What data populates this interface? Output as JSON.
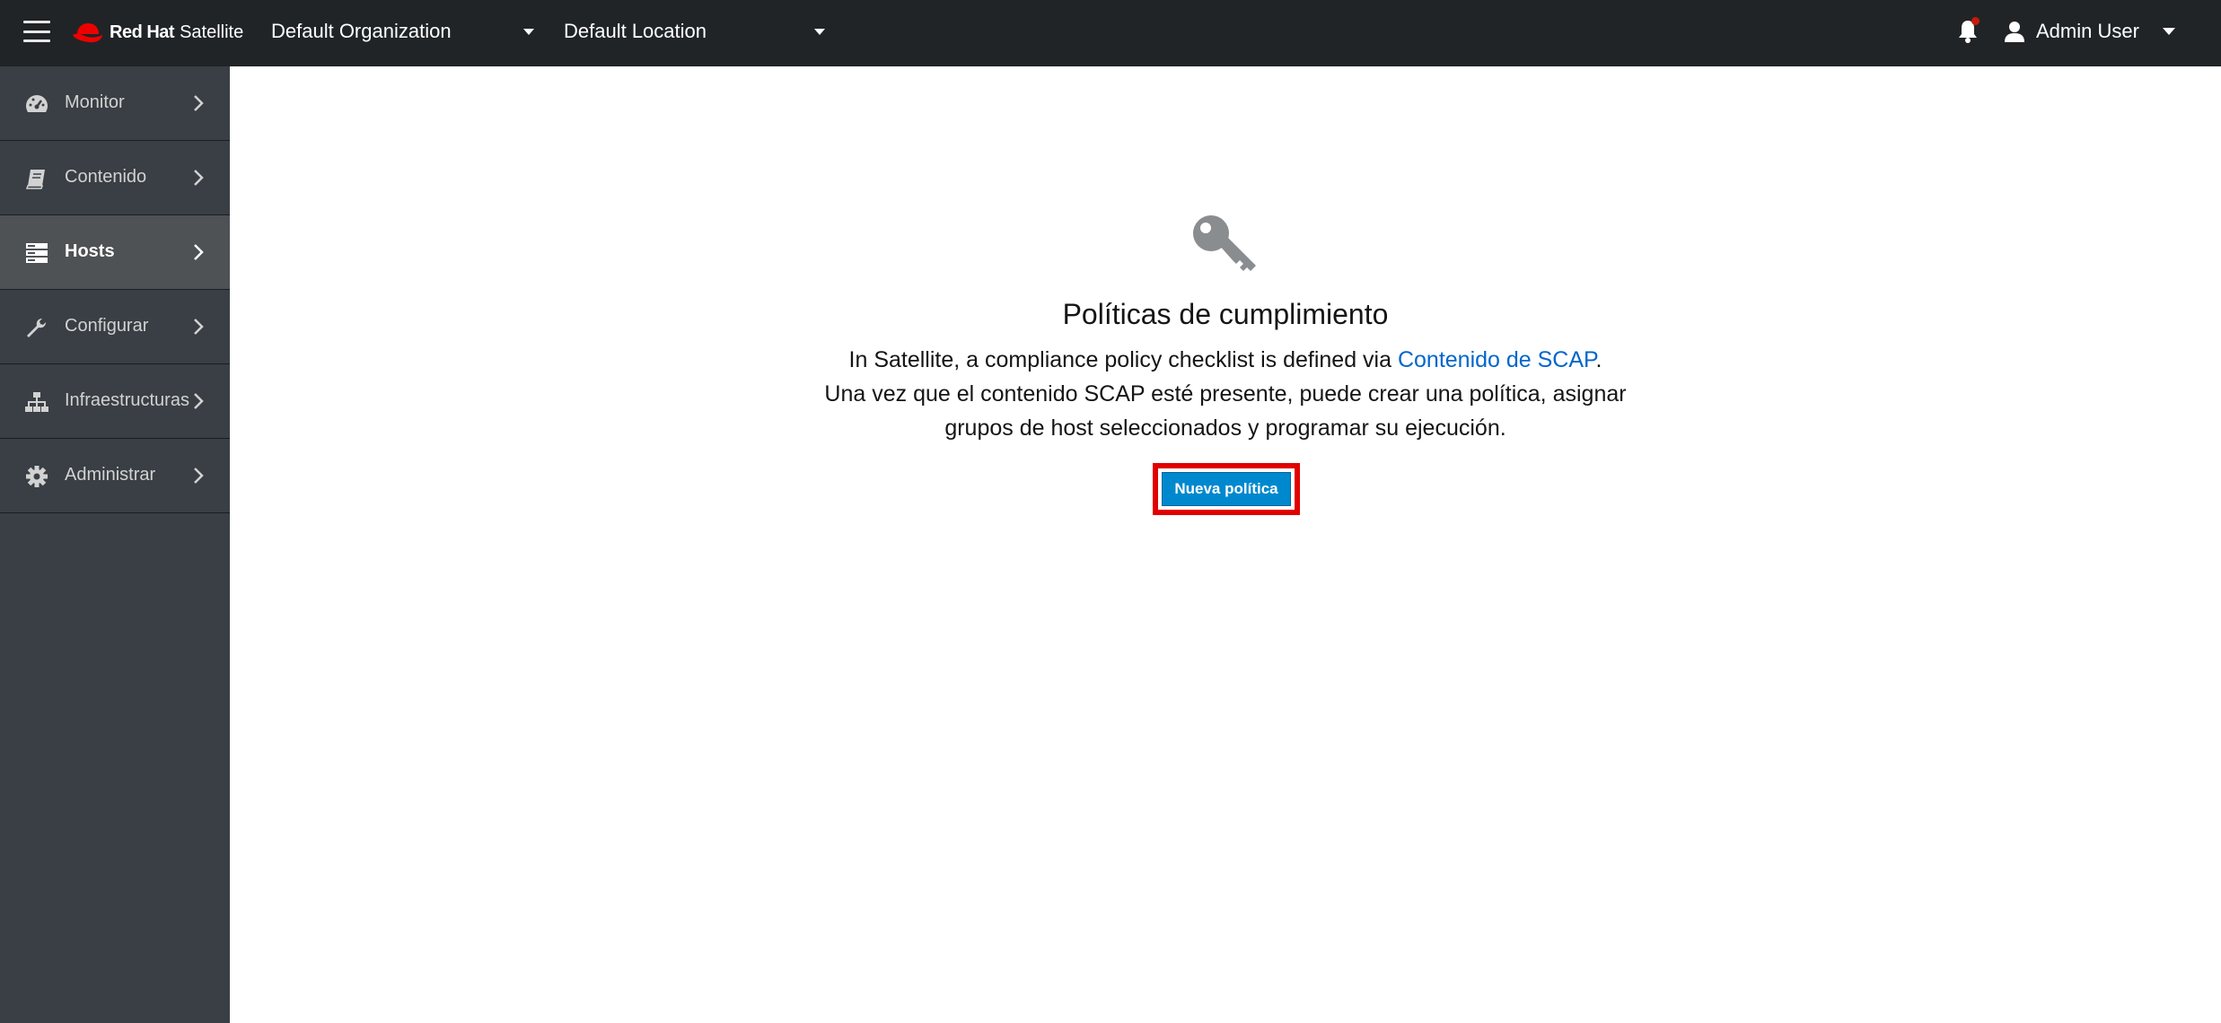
{
  "masthead": {
    "brand_bold": "Red Hat",
    "brand_product": "Satellite",
    "organization": "Default Organization",
    "location": "Default Location",
    "user": "Admin User",
    "brand_color": "#ee0000",
    "notification_color": "#c9190b"
  },
  "sidebar": {
    "items": [
      {
        "label": "Monitor",
        "icon": "dashboard-icon"
      },
      {
        "label": "Contenido",
        "icon": "book-icon"
      },
      {
        "label": "Hosts",
        "icon": "server-icon",
        "active": true
      },
      {
        "label": "Configurar",
        "icon": "wrench-icon"
      },
      {
        "label": "Infraestructuras",
        "icon": "sitemap-icon"
      },
      {
        "label": "Administrar",
        "icon": "gear-icon"
      }
    ]
  },
  "main": {
    "empty_state": {
      "icon": "key-icon",
      "title": "Políticas de cumplimiento",
      "line1_prefix": "In Satellite, a compliance policy checklist is defined via ",
      "line1_link": "Contenido de SCAP",
      "line1_suffix": ".",
      "line2": "Una vez que el contenido SCAP esté presente, puede crear una política, asignar",
      "line3": "grupos de host seleccionados y programar su ejecución.",
      "button_label": "Nueva política",
      "button_color": "#0088ce",
      "highlight_color": "#e00000"
    }
  }
}
